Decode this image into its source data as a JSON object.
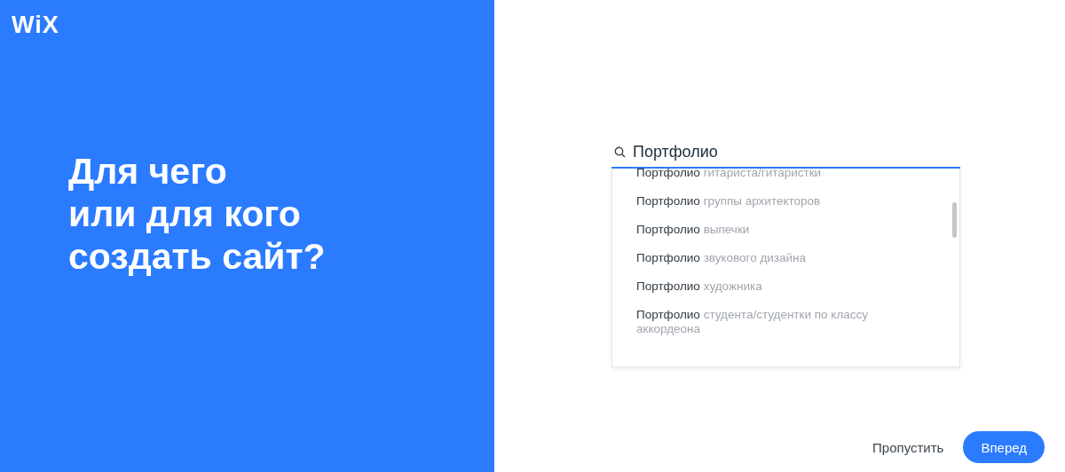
{
  "logo": "WiX",
  "heading_lines": [
    "Для чего",
    "или для кого",
    "создать сайт?"
  ],
  "search": {
    "value": "Портфолио"
  },
  "suggestions": [
    {
      "match": "Портфолио",
      "rest": "гитариста/гитаристки"
    },
    {
      "match": "Портфолио",
      "rest": "группы архитекторов"
    },
    {
      "match": "Портфолио",
      "rest": "выпечки"
    },
    {
      "match": "Портфолио",
      "rest": "звукового дизайна"
    },
    {
      "match": "Портфолио",
      "rest": "художника"
    },
    {
      "match": "Портфолио",
      "rest": "студента/студентки по классу аккордеона"
    }
  ],
  "buttons": {
    "skip": "Пропустить",
    "next": "Вперед"
  }
}
